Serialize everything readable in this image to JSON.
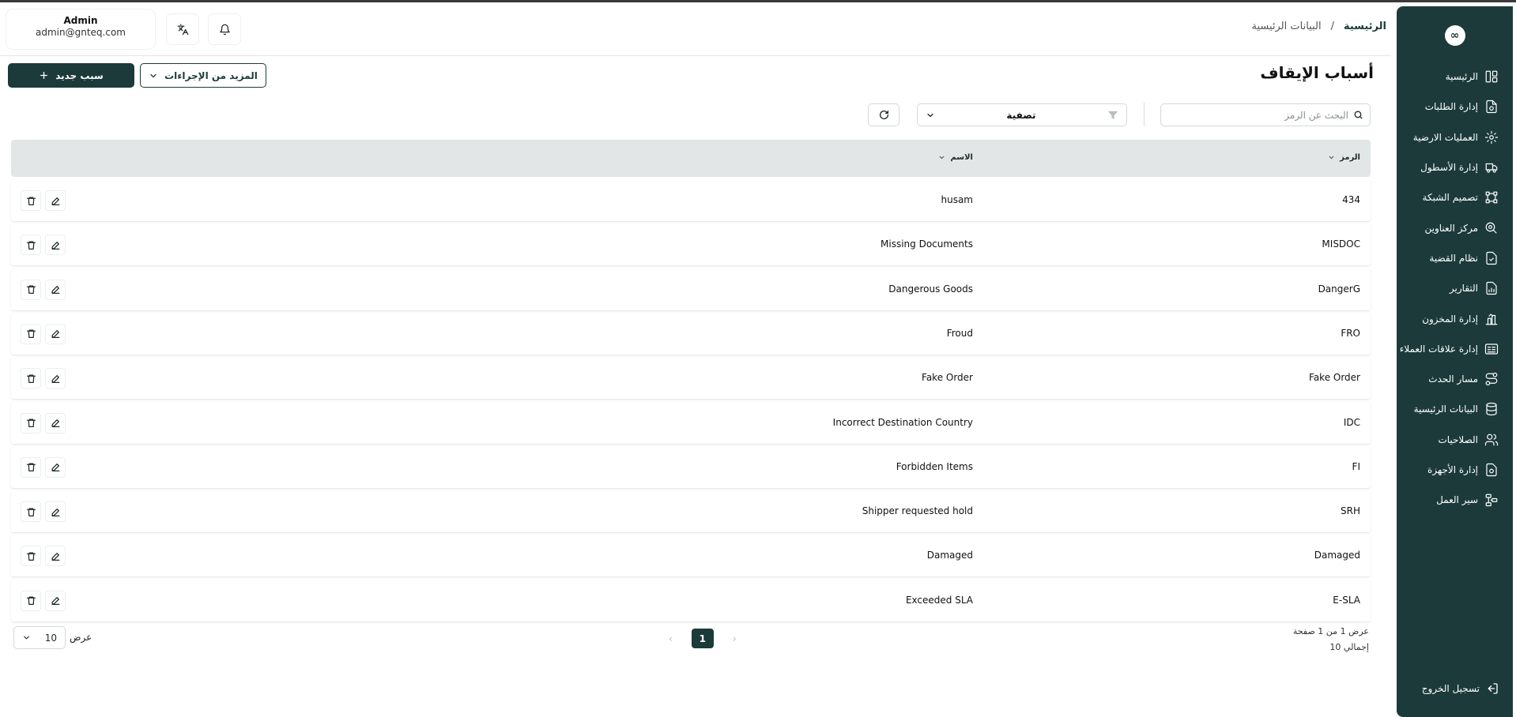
{
  "header": {
    "breadcrumb": {
      "home": "الرئيسية",
      "separator": "/",
      "current": "البيانات الرئيسية"
    },
    "user": {
      "name": "Admin",
      "email": "admin@gnteq.com"
    },
    "icons": {
      "language": "translate-icon",
      "notifications": "bell-icon"
    }
  },
  "sidebar": {
    "logo": "∞",
    "items": [
      {
        "label": "الرئيسية",
        "icon": "dashboard-icon"
      },
      {
        "label": "إدارة الطلبات",
        "icon": "orders-icon"
      },
      {
        "label": "العمليات الارضية",
        "icon": "ground-ops-icon"
      },
      {
        "label": "إدارة الأسطول",
        "icon": "truck-icon"
      },
      {
        "label": "تصميم الشبكة",
        "icon": "network-icon"
      },
      {
        "label": "مركز العناوين",
        "icon": "address-icon"
      },
      {
        "label": "نظام القضية",
        "icon": "case-icon"
      },
      {
        "label": "التقارير",
        "icon": "reports-icon"
      },
      {
        "label": "إدارة المخزون",
        "icon": "inventory-icon"
      },
      {
        "label": "إدارة علاقات العملاء",
        "icon": "crm-icon"
      },
      {
        "label": "مسار الحدث",
        "icon": "event-route-icon"
      },
      {
        "label": "البيانات الرئيسية",
        "icon": "database-icon"
      },
      {
        "label": "الصلاحيات",
        "icon": "users-icon"
      },
      {
        "label": "إدارة الأجهزة",
        "icon": "devices-icon"
      },
      {
        "label": "سير العمل",
        "icon": "workflow-icon"
      }
    ],
    "logout": "تسجيل الخروج"
  },
  "page": {
    "title": "أسباب الإيقاف",
    "new_button": "سبب جديد",
    "more_actions": "المزيد من الإجراءات"
  },
  "toolbar": {
    "search_placeholder": "البحث عن الرمز",
    "filter_label": "تصفية"
  },
  "table": {
    "columns": {
      "code": "الرمز",
      "name": "الاسم"
    },
    "rows": [
      {
        "code": "434",
        "name": "husam"
      },
      {
        "code": "MISDOC",
        "name": "Missing Documents"
      },
      {
        "code": "DangerG",
        "name": "Dangerous Goods"
      },
      {
        "code": "FRO",
        "name": "Froud"
      },
      {
        "code": "Fake Order",
        "name": "Fake Order"
      },
      {
        "code": "IDC",
        "name": "Incorrect Destination Country"
      },
      {
        "code": "FI",
        "name": "Forbidden Items"
      },
      {
        "code": "SRH",
        "name": "Shipper requested hold"
      },
      {
        "code": "Damaged",
        "name": "Damaged"
      },
      {
        "code": "E-SLA",
        "name": "Exceeded SLA"
      }
    ]
  },
  "footer": {
    "page_info": "عرض 1 من 1 صفحة",
    "total": "إجمالي 10",
    "current_page": "1",
    "per_page_label": "عرض",
    "per_page_value": "10"
  },
  "colors": {
    "primary": "#1c3a3a",
    "header_bg": "#e2e6e6"
  }
}
